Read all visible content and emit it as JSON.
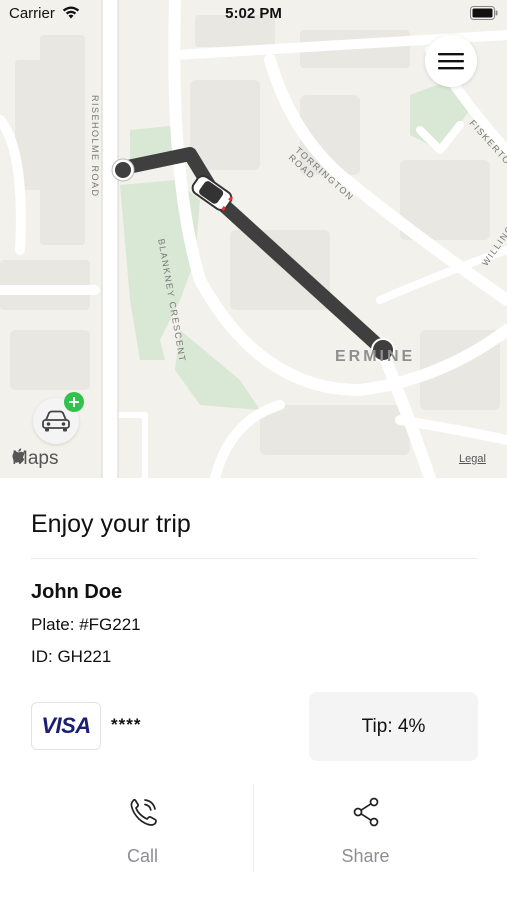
{
  "status_bar": {
    "carrier": "Carrier",
    "time": "5:02 PM"
  },
  "map": {
    "street_labels": [
      "RISEHOLME ROAD",
      "TORRINGTON ROAD",
      "BLANKNEY CRESCENT",
      "FISKERTON",
      "WILLING"
    ],
    "area_label": "ERMINE",
    "attribution": "Maps",
    "legal": "Legal",
    "route_color": "#3f3f3f"
  },
  "trip": {
    "title": "Enjoy your trip",
    "driver_name": "John Doe",
    "plate": "Plate: #FG221",
    "driver_id": "ID: GH221"
  },
  "payment": {
    "card_brand": "VISA",
    "card_mask": "****",
    "tip": "Tip: 4%"
  },
  "actions": {
    "call_label": "Call",
    "share_label": "Share"
  },
  "icons": {
    "menu": "hamburger-menu-icon",
    "car": "car-icon",
    "call": "phone-icon",
    "share": "share-icon"
  }
}
